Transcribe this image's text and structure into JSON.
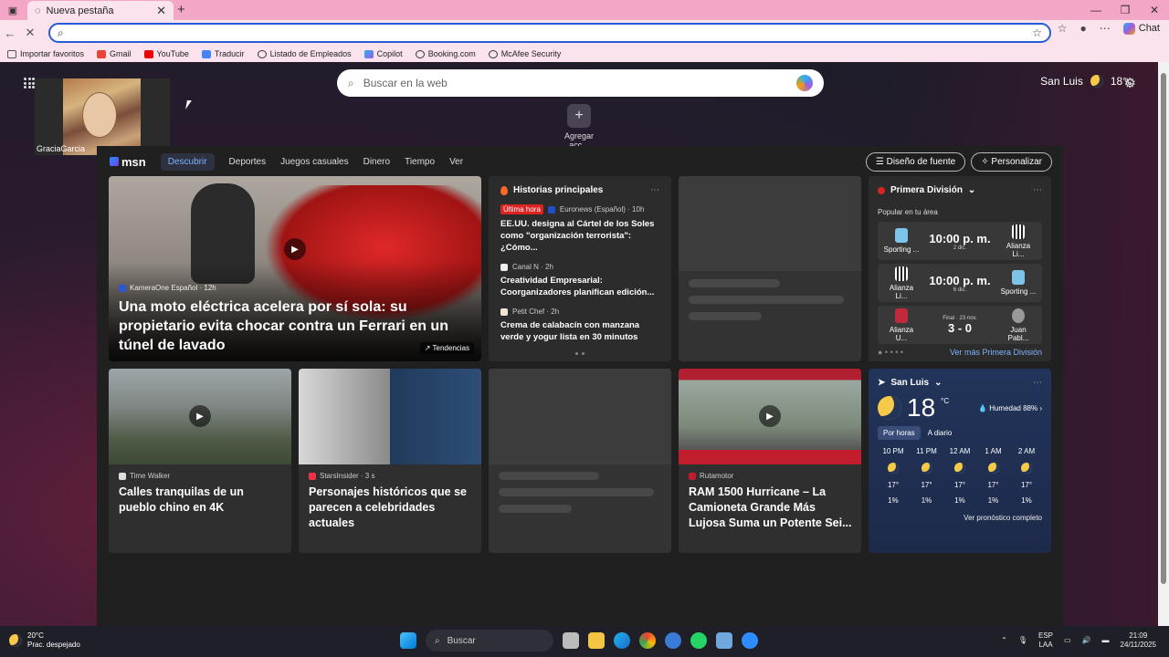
{
  "browser": {
    "tab_title": "Nueva pestaña",
    "address_value": "",
    "chat_label": "Chat",
    "bookmarks": [
      "Importar favoritos",
      "Gmail",
      "YouTube",
      "Traducir",
      "Listado de Empleados",
      "Copilot",
      "Booking.com",
      "McAfee Security"
    ]
  },
  "page": {
    "webcam_name": "GraciaGarcia",
    "search_placeholder": "Buscar en la web",
    "add_label": "Agregar acc...",
    "location": "San Luis",
    "temp_top": "18°c",
    "nav": {
      "logo": "msn",
      "items": [
        "Descubrir",
        "Deportes",
        "Juegos casuales",
        "Dinero",
        "Tiempo",
        "Ver"
      ],
      "font_btn": "Diseño de fuente",
      "personalize_btn": "Personalizar"
    },
    "hero": {
      "source": "KameraOne Español · 12h",
      "title": "Una moto eléctrica acelera por sí sola: su propietario evita chocar contra un Ferrari en un túnel de lavado",
      "trend": "Tendencias"
    },
    "top_stories": {
      "heading": "Historias principales",
      "stories": [
        {
          "badge": "Última hora",
          "meta": "Euronews (Español) · 10h",
          "title": "EE.UU. designa al Cártel de los Soles como \"organización terrorista\": ¿Cómo..."
        },
        {
          "badge": "",
          "meta": "Canal N · 2h",
          "title": "Creatividad Empresarial: Coorganizadores planifican edición..."
        },
        {
          "badge": "",
          "meta": "Petit Chef · 2h",
          "title": "Crema de calabacín con manzana verde y yogur lista en 30 minutos"
        }
      ]
    },
    "sports": {
      "heading": "Primera División",
      "popular": "Popular en tu área",
      "matches": [
        {
          "home": "Sporting ...",
          "score": "10:00 p. m.",
          "sub": "2 dic.",
          "away": "Alianza Li..."
        },
        {
          "home": "Alianza Li...",
          "score": "10:00 p. m.",
          "sub": "6 dic.",
          "away": "Sporting ..."
        },
        {
          "home": "Alianza U...",
          "score": "3 - 0",
          "sub": "Final · 23 nov.",
          "away": "Juan Pabl..."
        }
      ],
      "more_link": "Ver más Primera División"
    },
    "cards": [
      {
        "source": "Time Walker",
        "title": "Calles tranquilas de un pueblo chino en 4K"
      },
      {
        "source": "StarsInsider · 3 s",
        "title": "Personajes históricos que se parecen a celebridades actuales"
      },
      {
        "source": "Rutamotor",
        "title": "RAM 1500 Hurricane – La Camioneta Grande Más Lujosa Suma un Potente Sei..."
      }
    ],
    "weather": {
      "location": "San Luis",
      "temp": "18",
      "unit": "°C",
      "humidity": "Humedad 88%",
      "tab_hourly": "Por horas",
      "tab_daily": "A diario",
      "hours": [
        {
          "time": "10 PM",
          "temp": "17°",
          "rain": "1%"
        },
        {
          "time": "11 PM",
          "temp": "17°",
          "rain": "1%"
        },
        {
          "time": "12 AM",
          "temp": "17°",
          "rain": "1%"
        },
        {
          "time": "1 AM",
          "temp": "17°",
          "rain": "1%"
        },
        {
          "time": "2 AM",
          "temp": "17°",
          "rain": "1%"
        }
      ],
      "forecast_link": "Ver pronóstico completo"
    }
  },
  "taskbar": {
    "weather_temp": "20°C",
    "weather_desc": "Prac. despejado",
    "search": "Buscar",
    "lang": "ESP",
    "lang2": "LAA",
    "time": "21:09",
    "date": "24/11/2025"
  }
}
